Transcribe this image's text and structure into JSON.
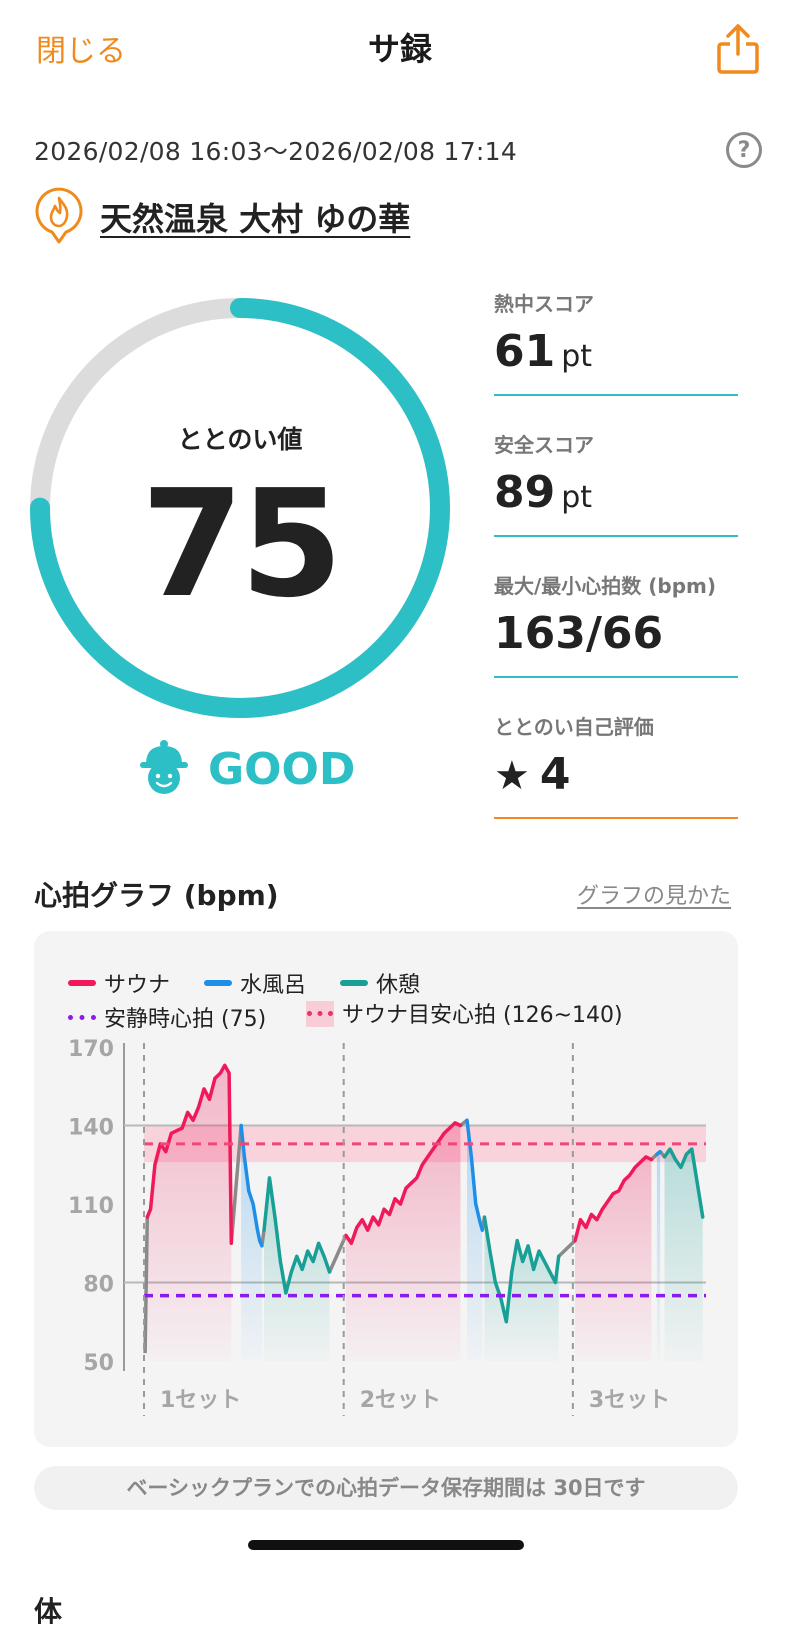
{
  "nav": {
    "close_label": "閉じる",
    "title": "サ録",
    "share_icon": "share-icon"
  },
  "session": {
    "datetime": "2026/02/08 16:03～2026/02/08 17:14",
    "help_icon": "question-icon",
    "help_text": "?",
    "facility_icon": "sauna-flame-pin-icon",
    "facility_name": "天然温泉 大村 ゆの華"
  },
  "score": {
    "label": "ととのい値",
    "value": "75",
    "progress": 0.75,
    "rating_icon": "good-face-icon",
    "rating": "GOOD",
    "colors": {
      "track": "#dcdcdc",
      "fill": "#2dbfc6",
      "accent": "#f08a1c"
    }
  },
  "stats": [
    {
      "label": "熱中スコア",
      "value": "61",
      "unit": "pt"
    },
    {
      "label": "安全スコア",
      "value": "89",
      "unit": "pt"
    },
    {
      "label": "最大/最小心拍数 (bpm)",
      "value": "163/66",
      "unit": ""
    },
    {
      "label": "ととのい自己評価",
      "value": "4",
      "unit": "",
      "icon": "star-icon",
      "star": "★"
    }
  ],
  "graph": {
    "title": "心拍グラフ (bpm)",
    "help_link": "グラフの見かた",
    "legend": {
      "sauna": "サウナ",
      "cold": "水風呂",
      "rest": "休憩",
      "resting_hr": "安静時心拍 (75)",
      "target_hr": "サウナ目安心拍 (126~140)"
    },
    "retention_note": "ベーシックプランでの心拍データ保存期間は 30日です",
    "next_heading": "体"
  },
  "chart_data": {
    "type": "line",
    "title": "心拍グラフ (bpm)",
    "ylabel": "",
    "xlabel": "",
    "ylim": [
      50,
      170
    ],
    "yticks": [
      170,
      140,
      110,
      80,
      50
    ],
    "set_labels": [
      "1セット",
      "2セット",
      "3セット"
    ],
    "colors": {
      "sauna": "#f0195a",
      "cold": "#1e8fe8",
      "rest": "#19a096",
      "gap": "#8a8a8a",
      "resting": "#8c1aeb",
      "target": "#f0467a"
    },
    "reference_lines": {
      "resting_hr": 75,
      "target_band": [
        126,
        140
      ],
      "target_mid": 133
    },
    "series": [
      {
        "name": "サウナ",
        "x": [
          0.3,
          0.6,
          1.0,
          1.5,
          2.0,
          2.5,
          3.0,
          3.5,
          4.0,
          4.5,
          5.0,
          5.5,
          6.0,
          6.5,
          7.0,
          7.4,
          7.8,
          8.0
        ],
        "values": [
          105,
          108,
          125,
          133,
          130,
          137,
          138,
          139,
          145,
          142,
          147,
          154,
          150,
          158,
          160,
          163,
          160,
          95
        ]
      },
      {
        "name": "水風呂",
        "x": [
          8.9,
          9.2,
          9.6,
          10.0,
          10.4,
          10.6,
          10.8
        ],
        "values": [
          140,
          128,
          115,
          110,
          100,
          96,
          94
        ]
      },
      {
        "name": "休憩",
        "x": [
          11.0,
          11.5,
          12.0,
          12.5,
          13.0,
          13.5,
          14.0,
          14.5,
          15.0,
          15.5,
          16.0,
          16.5,
          17.0
        ],
        "values": [
          100,
          120,
          105,
          88,
          76,
          84,
          90,
          85,
          92,
          88,
          95,
          90,
          84
        ]
      },
      {
        "name": "サウナ",
        "x": [
          18.5,
          19.0,
          19.5,
          20.0,
          20.5,
          21.0,
          21.5,
          22.0,
          22.5,
          23.0,
          23.5,
          24.0,
          24.5,
          25.0,
          25.5,
          26.0,
          26.5,
          27.0,
          27.5,
          28.0,
          28.5,
          29.0
        ],
        "values": [
          98,
          95,
          101,
          104,
          100,
          105,
          102,
          108,
          106,
          112,
          110,
          116,
          118,
          120,
          125,
          128,
          131,
          134,
          137,
          139,
          141,
          140
        ]
      },
      {
        "name": "水風呂",
        "x": [
          29.6,
          30.0,
          30.4,
          30.8,
          31.0
        ],
        "values": [
          142,
          128,
          110,
          103,
          100
        ]
      },
      {
        "name": "休憩",
        "x": [
          31.2,
          31.7,
          32.2,
          32.7,
          33.2,
          33.7,
          34.2,
          34.7,
          35.2,
          35.7,
          36.2,
          36.7,
          37.2,
          37.7,
          38.0
        ],
        "values": [
          105,
          92,
          80,
          74,
          65,
          84,
          96,
          88,
          94,
          85,
          92,
          88,
          84,
          80,
          90
        ]
      },
      {
        "name": "サウナ",
        "x": [
          39.5,
          40.0,
          40.5,
          41.0,
          41.5,
          42.0,
          42.5,
          43.0,
          43.5,
          44.0,
          44.5,
          45.0,
          45.5,
          46.0,
          46.5
        ],
        "values": [
          96,
          104,
          101,
          106,
          104,
          108,
          111,
          114,
          115,
          119,
          121,
          124,
          126,
          128,
          127
        ]
      },
      {
        "name": "水風呂",
        "x": [
          47.0,
          47.3
        ],
        "values": [
          129,
          130
        ]
      },
      {
        "name": "休憩",
        "x": [
          47.7,
          48.2,
          48.7,
          49.2,
          49.7,
          50.2,
          50.7,
          51.2
        ],
        "values": [
          128,
          131,
          127,
          124,
          129,
          131,
          118,
          105
        ]
      }
    ],
    "x_range": [
      0,
      51.5
    ],
    "set_boundaries": [
      0.0,
      18.3,
      39.3
    ]
  }
}
